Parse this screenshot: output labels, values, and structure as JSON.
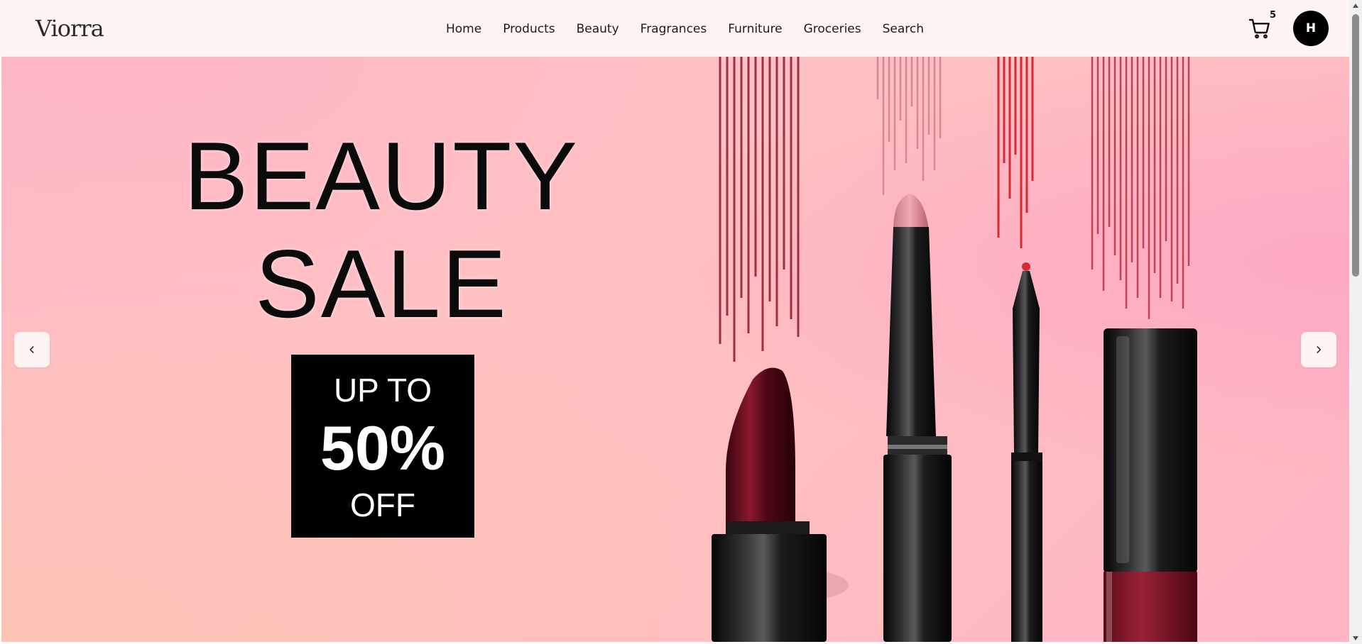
{
  "header": {
    "logo": "Viorra",
    "nav": [
      "Home",
      "Products",
      "Beauty",
      "Fragrances",
      "Furniture",
      "Groceries",
      "Search"
    ],
    "cart_count": "5",
    "cart_icon": "cart-icon",
    "avatar_initial": "H"
  },
  "hero": {
    "title_line1": "BEAUTY",
    "title_line2": "SALE",
    "promo_line1": "UP TO",
    "promo_line2": "50%",
    "promo_line3": "OFF",
    "prev_icon": "chevron-left-icon",
    "next_icon": "chevron-right-icon"
  },
  "colors": {
    "header_bg": "#fff4f4",
    "hero_bg": "#ffbfc4",
    "promo_bg": "#000000",
    "avatar_bg": "#000000"
  }
}
